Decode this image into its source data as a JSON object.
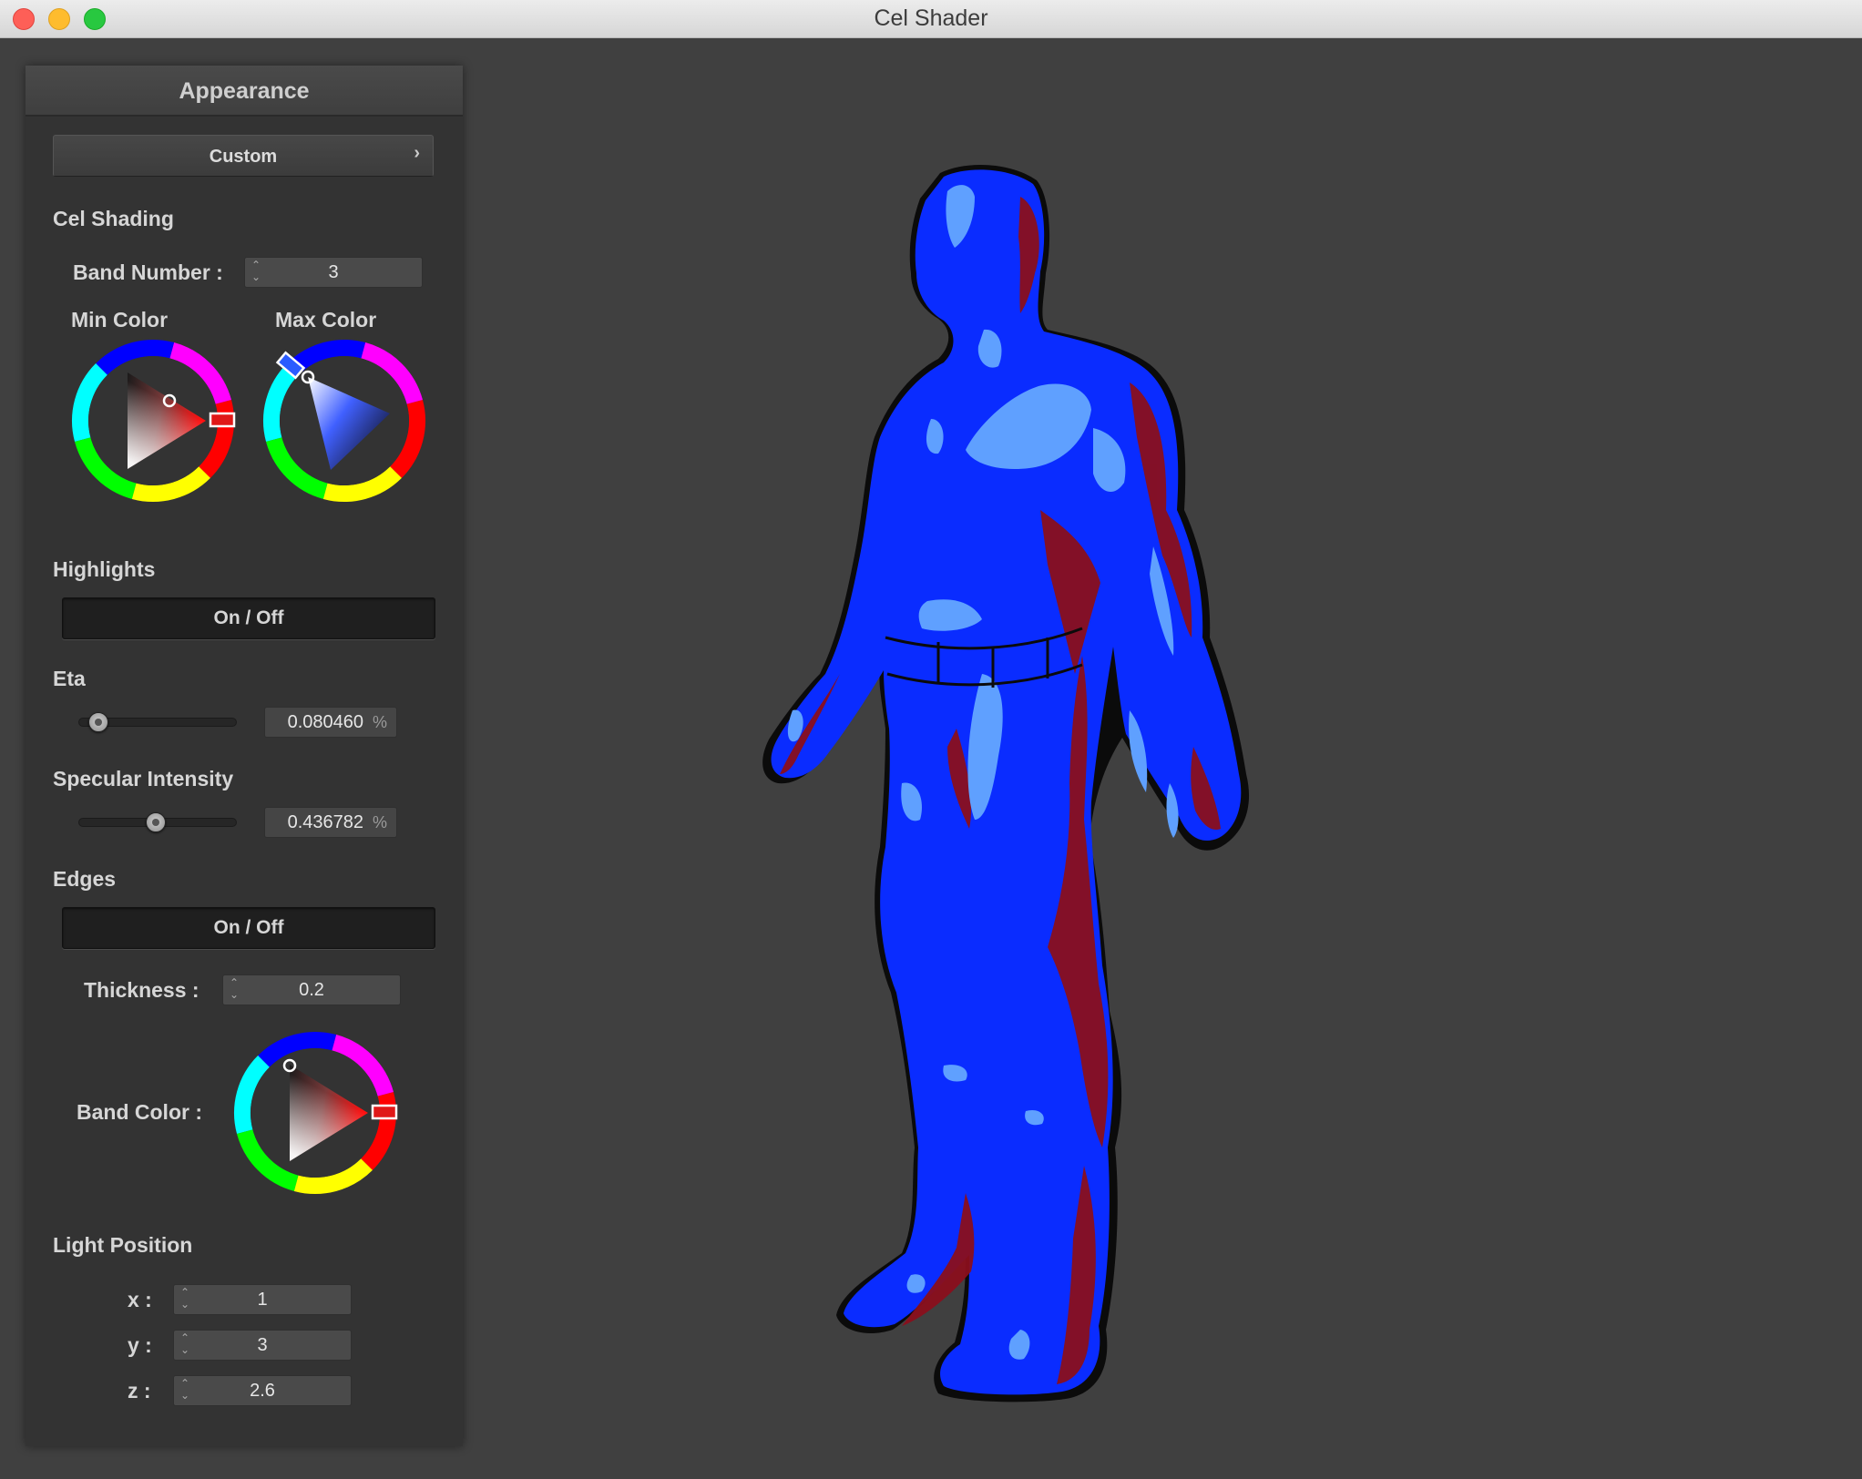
{
  "window": {
    "title": "Cel Shader"
  },
  "panel": {
    "header": "Appearance",
    "preset": {
      "label": "Custom",
      "chevron": "›"
    },
    "cel_shading": {
      "title": "Cel Shading",
      "band_number_label": "Band Number :",
      "band_number_value": "3",
      "min_color_label": "Min Color",
      "max_color_label": "Max Color",
      "min_color": "#b31a1a",
      "max_color": "#2a5cff"
    },
    "highlights": {
      "title": "Highlights",
      "toggle_label": "On / Off",
      "eta_label": "Eta",
      "eta_value": "0.080460",
      "eta_fraction": 0.08,
      "eta_unit": "%",
      "specular_label": "Specular Intensity",
      "specular_value": "0.436782",
      "specular_fraction": 0.44,
      "specular_unit": "%"
    },
    "edges": {
      "title": "Edges",
      "toggle_label": "On / Off",
      "thickness_label": "Thickness :",
      "thickness_value": "0.2",
      "band_color_label": "Band Color :",
      "band_color": "#c81a1a"
    },
    "light_position": {
      "title": "Light Position",
      "x_label": "x :",
      "x_value": "1",
      "y_label": "y :",
      "y_value": "3",
      "z_label": "z :",
      "z_value": "2.6"
    }
  },
  "viewport": {
    "background": "#404040",
    "model_base_color": "#0a2cff",
    "model_highlight_color": "#5fa0ff",
    "model_shadow_color": "#8a0f1c"
  }
}
